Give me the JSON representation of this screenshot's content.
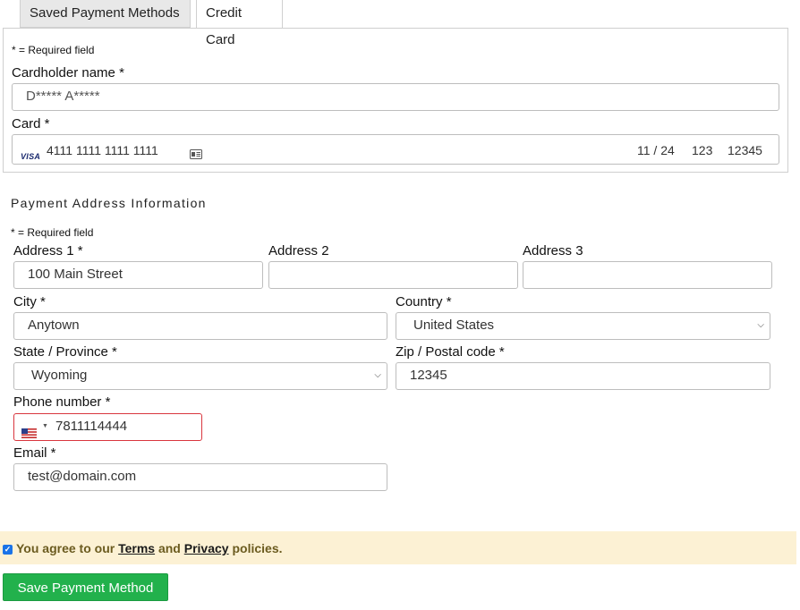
{
  "tabs": [
    {
      "label": "Saved Payment Methods"
    },
    {
      "label": "Credit Card"
    }
  ],
  "card_section": {
    "required_note": "* = Required field",
    "cardholder_label": "Cardholder name *",
    "cardholder_value": "D***** A*****",
    "card_label": "Card *",
    "card_brand": "VISA",
    "card_number": "4111 1111 1111 1111",
    "expiry": "11 / 24",
    "cvc": "123",
    "postal": "12345"
  },
  "address_section": {
    "title": "Payment Address Information",
    "required_note": "* = Required field",
    "address1_label": "Address 1 *",
    "address1_value": "100 Main Street",
    "address2_label": "Address 2",
    "address2_value": "",
    "address3_label": "Address 3",
    "address3_value": "",
    "city_label": "City *",
    "city_value": "Anytown",
    "country_label": "Country *",
    "country_value": "United States",
    "state_label": "State / Province *",
    "state_value": "Wyoming",
    "zip_label": "Zip / Postal code *",
    "zip_value": "12345",
    "phone_label": "Phone number *",
    "phone_value": "7811114444",
    "email_label": "Email *",
    "email_value": "test@domain.com"
  },
  "agreement": {
    "prefix": "You agree to our ",
    "terms": "Terms",
    "and": " and ",
    "privacy": "Privacy",
    "suffix": " policies.",
    "checked": true
  },
  "save_button": "Save Payment Method",
  "colors": {
    "save_button": "#22b14c",
    "agree_bg": "#fcf1d4",
    "phone_border_error": "#d9363e",
    "checkbox": "#1a73e8"
  },
  "icons": {
    "card_brand": "visa-logo",
    "card_scan": "card-icon",
    "select_arrow": "chevron-down-icon",
    "phone_flag": "us-flag-icon"
  }
}
